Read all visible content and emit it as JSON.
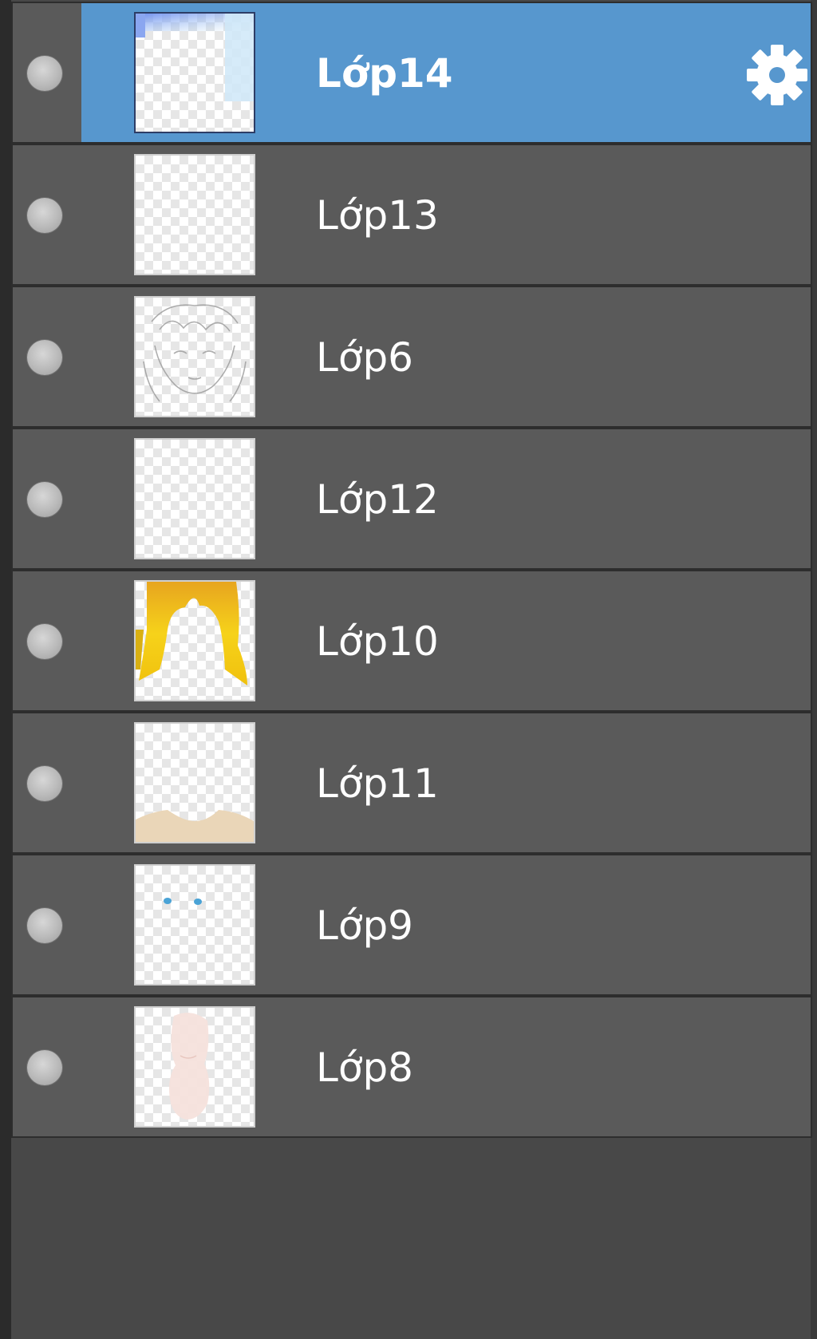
{
  "layers_panel": {
    "selected_index": 0,
    "colors": {
      "panel_bg": "#484848",
      "row_bg": "#5a5a5a",
      "selected_bg": "#5797ce",
      "text": "#ffffff"
    },
    "layers": [
      {
        "name": "Lớp14",
        "thumbnail": "sky-blue-corner",
        "selected": true
      },
      {
        "name": "Lớp13",
        "thumbnail": "transparent"
      },
      {
        "name": "Lớp6",
        "thumbnail": "sketch-lines"
      },
      {
        "name": "Lớp12",
        "thumbnail": "transparent"
      },
      {
        "name": "Lớp10",
        "thumbnail": "yellow-hair"
      },
      {
        "name": "Lớp11",
        "thumbnail": "skin-shoulders"
      },
      {
        "name": "Lớp9",
        "thumbnail": "blue-eyes"
      },
      {
        "name": "Lớp8",
        "thumbnail": "pale-body"
      }
    ],
    "icons": {
      "visibility": "visibility-dot-icon",
      "settings": "gear-icon"
    }
  }
}
